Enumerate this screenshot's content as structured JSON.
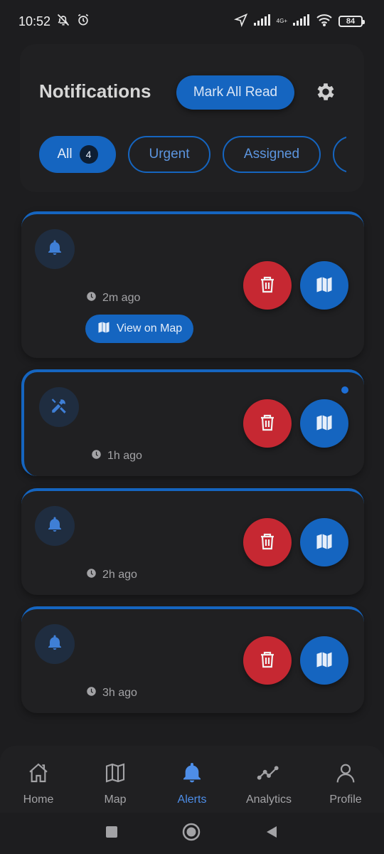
{
  "status_bar": {
    "time": "10:52",
    "network_tag": "4G+",
    "battery": "84"
  },
  "header": {
    "title": "Notifications",
    "mark_all_read_label": "Mark All Read"
  },
  "filters": {
    "chips": [
      {
        "label": "All",
        "count": "4",
        "active": true
      },
      {
        "label": "Urgent",
        "active": false
      },
      {
        "label": "Assigned",
        "active": false
      }
    ]
  },
  "notifications": [
    {
      "icon": "bell-icon",
      "time": "2m ago",
      "action_label": "View on Map",
      "unread": false
    },
    {
      "icon": "tools-icon",
      "time": "1h ago",
      "unread": true
    },
    {
      "icon": "bell-icon",
      "time": "2h ago",
      "unread": false
    },
    {
      "icon": "bell-icon",
      "time": "3h ago",
      "unread": false
    }
  ],
  "bottom_nav": {
    "items": [
      {
        "label": "Home",
        "icon": "home-icon"
      },
      {
        "label": "Map",
        "icon": "map-icon"
      },
      {
        "label": "Alerts",
        "icon": "bell-icon",
        "active": true
      },
      {
        "label": "Analytics",
        "icon": "analytics-icon"
      },
      {
        "label": "Profile",
        "icon": "profile-icon"
      }
    ]
  },
  "colors": {
    "accent": "#1565c0",
    "delete": "#c62832",
    "background": "#1d1d1f",
    "card": "#202022"
  }
}
